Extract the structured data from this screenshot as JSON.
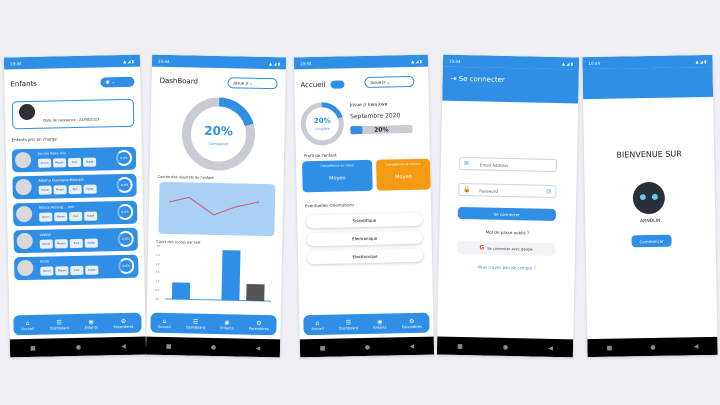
{
  "status": {
    "time": "10:44",
    "icons": "▲ ◢ ▮"
  },
  "s1": {
    "title": "Enfants",
    "child_date": "Date de naissance : 22/08/2023",
    "section": "Enfants pris en charge",
    "kids": [
      {
        "name": "Jorune Kesa Ivia"
      },
      {
        "name": "Adama Ousmane Mamadi"
      },
      {
        "name": "Ntoua Assang .. doh"
      },
      {
        "name": "ppppp"
      },
      {
        "name": "hhhh"
      }
    ],
    "tags": [
      "Aucun",
      "Moyen",
      "Fort",
      "Faible"
    ],
    "pct": "0.0%",
    "nav": [
      "Accueil",
      "Dashboard",
      "Enfants",
      "Paramètres"
    ]
  },
  "s2": {
    "title": "DashBoard",
    "user": "Josue Jr",
    "progress": 0.2,
    "progress_label": "20%",
    "completed": "Completed",
    "chart1_title": "Courbe des résultats de l'enfant",
    "chart2_title": "Cours des scores par test",
    "bars": [
      1,
      0,
      3,
      1
    ],
    "ylabels": [
      "3.0",
      "2.5",
      "2.0",
      "1.5",
      "1.0",
      "0.5",
      "0.0"
    ],
    "nav": [
      "Accueil",
      "DashBoard",
      "Enfants",
      "Paramètres"
    ]
  },
  "s3": {
    "title": "Accueil",
    "user": "Josue Jr",
    "child_name": "Josue jr kwa kwa",
    "date": "Septembre 2020",
    "pct": "20%",
    "progress": 0.2,
    "circle_pct": "20%",
    "completed": "Complété",
    "profile": "Profil de l'enfant",
    "card1_title": "Compétence en calcul",
    "card1_value": "Tebe fort",
    "card2_title": "Compétence en lecture",
    "card2_value": "Moyen",
    "orient_title": "Eventuelles Orientations",
    "orient": [
      "Scientifique",
      "Electronique",
      "Electronique"
    ],
    "nav": [
      "Accueil",
      "Dashboard",
      "Enfants",
      "Paramètres"
    ]
  },
  "s4": {
    "title": "Se connecter",
    "email": "Email Address",
    "password": "Password",
    "login": "Se connecter",
    "forgot": "Mot de passe oublié ?",
    "google": "Se connecter avec google",
    "no_account": "Vous n'avez pas de compte ?"
  },
  "s5": {
    "welcome": "BIENVENUE SUR",
    "brand": "ARNOLIN",
    "cta": "Commencer"
  }
}
